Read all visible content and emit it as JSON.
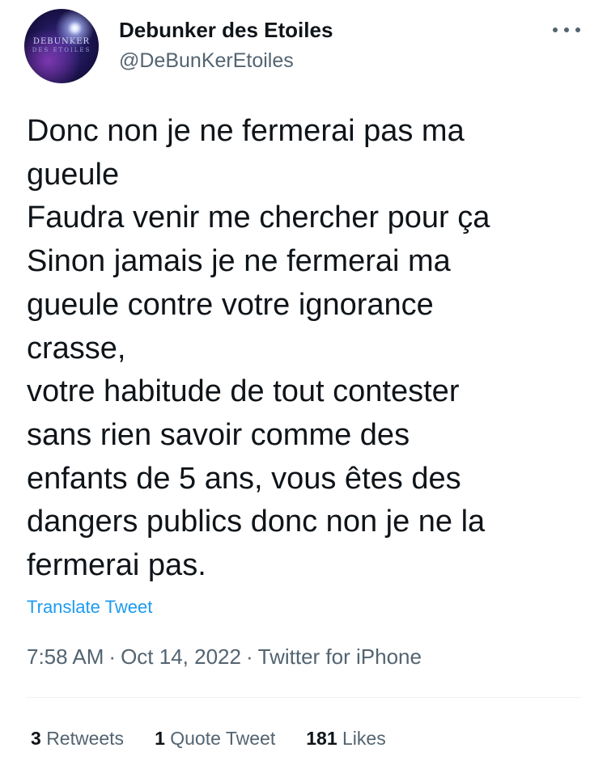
{
  "author": {
    "name": "Debunker des Etoiles",
    "handle": "@DeBunKerEtoiles",
    "avatar_text_line1": "DEBUNKER",
    "avatar_text_line2": "DES ETOILES"
  },
  "tweet": {
    "text": "Donc non je ne fermerai pas ma\ngueule\nFaudra venir me chercher pour ça\nSinon jamais je ne fermerai ma\ngueule contre votre ignorance\ncrasse,\nvotre habitude de tout contester\nsans rien savoir comme des\nenfants de 5 ans, vous êtes des\ndangers publics donc non je ne la\nfermerai pas.",
    "translate_label": "Translate Tweet"
  },
  "meta": {
    "time": "7:58 AM",
    "separator": "·",
    "date": "Oct 14, 2022",
    "source": "Twitter for iPhone"
  },
  "stats": {
    "retweets_count": "3",
    "retweets_label": "Retweets",
    "quotes_count": "1",
    "quotes_label": "Quote Tweet",
    "likes_count": "181",
    "likes_label": "Likes"
  },
  "icons": {
    "more": "more-horizontal-icon"
  },
  "colors": {
    "text": "#0f1419",
    "secondary": "#536471",
    "link": "#1d9bf0",
    "divider": "#eff3f4"
  }
}
